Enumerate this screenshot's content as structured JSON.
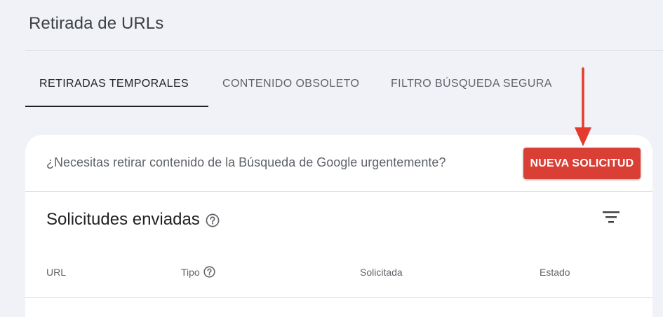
{
  "header": {
    "title": "Retirada de URLs"
  },
  "tabs": [
    {
      "label": "RETIRADAS TEMPORALES",
      "active": true
    },
    {
      "label": "CONTENIDO OBSOLETO",
      "active": false
    },
    {
      "label": "FILTRO BÚSQUEDA SEGURA",
      "active": false
    }
  ],
  "urgent": {
    "text": "¿Necesitas retirar contenido de la Búsqueda de Google urgentemente?",
    "button_label": "NUEVA SOLICITUD"
  },
  "requests": {
    "title": "Solicitudes enviadas",
    "help_icon": "help-circle-icon",
    "filter_icon": "filter-list-icon",
    "columns": [
      "URL",
      "Tipo",
      "Solicitada",
      "Estado"
    ]
  },
  "colors": {
    "accent_button": "#d93f35",
    "annotation_arrow": "#e53b2c",
    "background": "#f0f2f7"
  }
}
